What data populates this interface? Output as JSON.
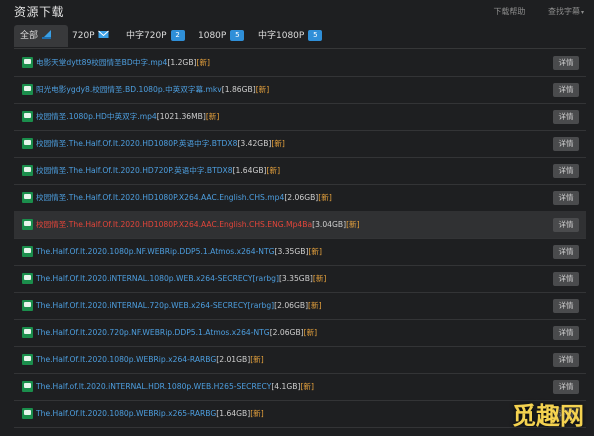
{
  "header": {
    "title": "资源下载",
    "help": "下载帮助",
    "find_subs": "查找字幕",
    "find_subs_arrow": "▾"
  },
  "tabs": [
    {
      "label": "全部",
      "badge": null
    },
    {
      "label": "720P",
      "badge": null
    },
    {
      "label": "中字720P",
      "badge": "2"
    },
    {
      "label": "1080P",
      "badge": "5"
    },
    {
      "label": "中字1080P",
      "badge": "5"
    }
  ],
  "files": [
    {
      "name": "电影天堂dytt89校园情圣BD中字.mp4",
      "size": "[1.2GB]",
      "new": "[新]",
      "detail": "详情"
    },
    {
      "name": "阳光电影ygdy8.校园情圣.BD.1080p.中英双字幕.mkv",
      "size": "[1.86GB]",
      "new": "[新]",
      "detail": "详情"
    },
    {
      "name": "校园情圣.1080p.HD中英双字.mp4",
      "size": "[1021.36MB]",
      "new": "[新]",
      "detail": "详情"
    },
    {
      "name": "校园情圣.The.Half.Of.It.2020.HD1080P.英语中字.BTDX8",
      "size": "[3.42GB]",
      "new": "[新]",
      "detail": "详情"
    },
    {
      "name": "校园情圣.The.Half.Of.It.2020.HD720P.英语中字.BTDX8",
      "size": "[1.64GB]",
      "new": "[新]",
      "detail": "详情"
    },
    {
      "name": "校园情圣.The.Half.Of.It.2020.HD1080P.X264.AAC.English.CHS.mp4",
      "size": "[2.06GB]",
      "new": "[新]",
      "detail": "详情"
    },
    {
      "name": "校园情圣.The.Half.Of.It.2020.HD1080P.X264.AAC.English.CHS.ENG.Mp4Ba",
      "size": "[3.04GB]",
      "new": "[新]",
      "detail": "详情",
      "highlight": true
    },
    {
      "name": "The.Half.Of.It.2020.1080p.NF.WEBRip.DDP5.1.Atmos.x264-NTG",
      "size": "[3.35GB]",
      "new": "[新]",
      "detail": "详情"
    },
    {
      "name": "The.Half.Of.It.2020.iNTERNAL.1080p.WEB.x264-SECRECY[rarbg]",
      "size": "[3.35GB]",
      "new": "[新]",
      "detail": "详情"
    },
    {
      "name": "The.Half.Of.It.2020.iNTERNAL.720p.WEB.x264-SECRECY[rarbg]",
      "size": "[2.06GB]",
      "new": "[新]",
      "detail": "详情"
    },
    {
      "name": "The.Half.Of.It.2020.720p.NF.WEBRip.DDP5.1.Atmos.x264-NTG",
      "size": "[2.06GB]",
      "new": "[新]",
      "detail": "详情"
    },
    {
      "name": "The.Half.Of.It.2020.1080p.WEBRip.x264-RARBG",
      "size": "[2.01GB]",
      "new": "[新]",
      "detail": "详情"
    },
    {
      "name": "The.Half.of.It.2020.iNTERNAL.HDR.1080p.WEB.H265-SECRECY",
      "size": "[4.1GB]",
      "new": "[新]",
      "detail": "详情"
    },
    {
      "name": "The.Half.Of.It.2020.1080p.WEBRip.x265-RARBG",
      "size": "[1.64GB]",
      "new": "[新]",
      "detail": "详情"
    }
  ],
  "watermark": "觅趣网",
  "colors": {
    "background": "#1e1f21",
    "link": "#4d9fe0",
    "highlight_link": "#e3453a",
    "new_tag": "#e8a33d",
    "badge": "#2f8fd8",
    "file_icon": "#1b8e4c"
  }
}
